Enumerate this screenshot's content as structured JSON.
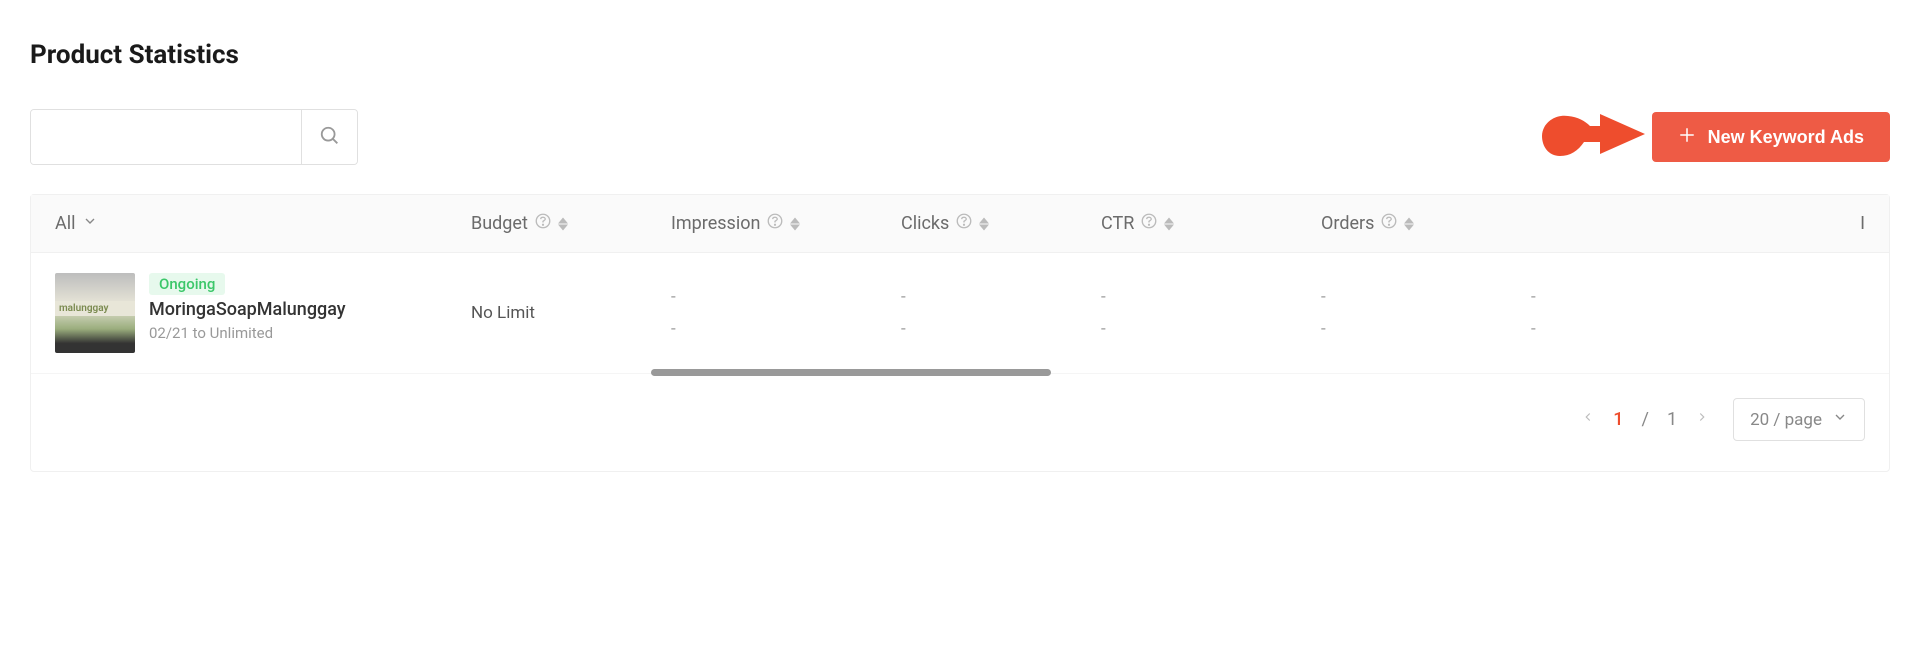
{
  "page": {
    "title": "Product Statistics"
  },
  "toolbar": {
    "search_placeholder": "",
    "new_ads_label": "New Keyword Ads"
  },
  "columns": {
    "filter_all": "All",
    "budget": "Budget",
    "impression": "Impression",
    "clicks": "Clicks",
    "ctr": "CTR",
    "orders": "Orders",
    "last": "I"
  },
  "rows": [
    {
      "thumb_text": "malunggay",
      "status": "Ongoing",
      "name": "MoringaSoapMalunggay",
      "date_range": "02/21 to Unlimited",
      "budget": "No Limit",
      "impression": "-",
      "impression2": "-",
      "clicks": "-",
      "clicks2": "-",
      "ctr": "-",
      "ctr2": "-",
      "orders": "-",
      "orders2": "-",
      "last": "-",
      "last2": "-"
    }
  ],
  "pagination": {
    "current": "1",
    "separator": "/",
    "total": "1",
    "page_size_label": "20 / page"
  }
}
